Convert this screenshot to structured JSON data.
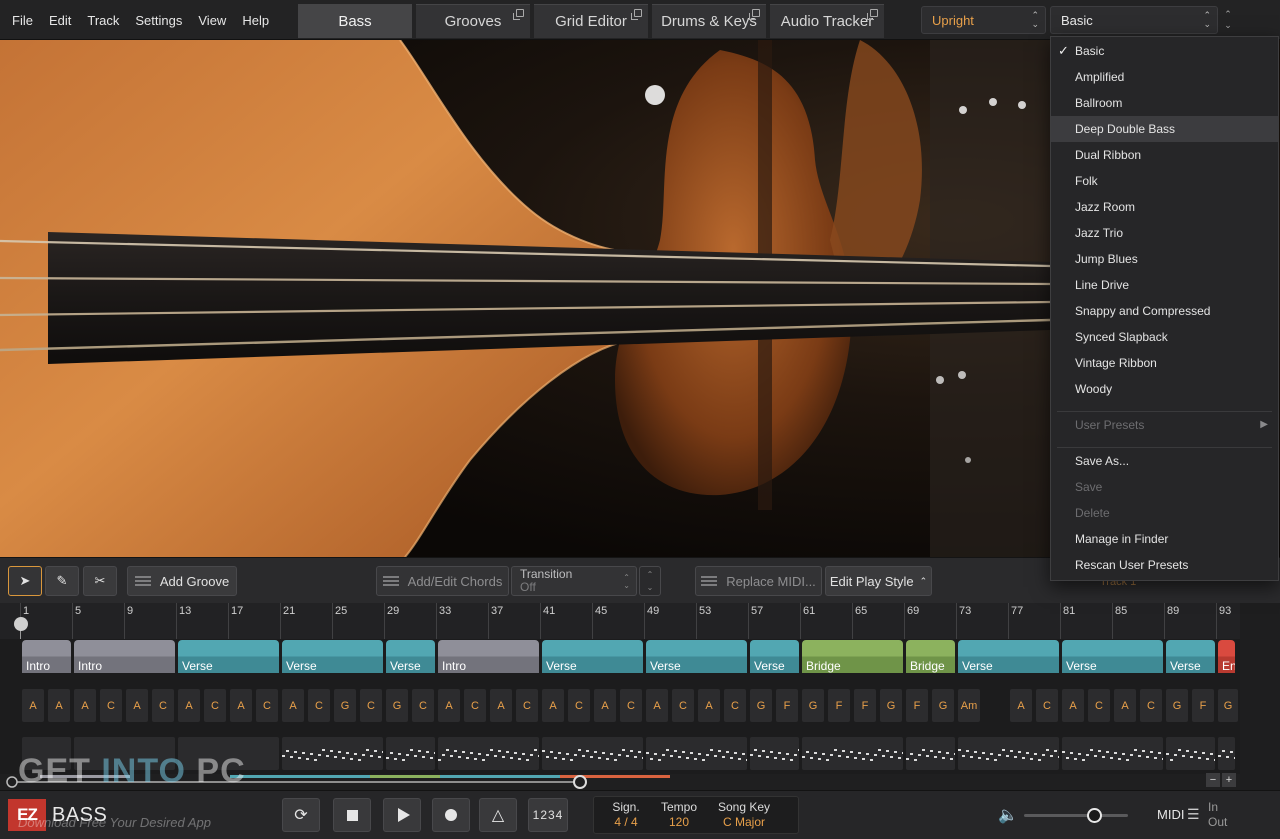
{
  "menu": [
    "File",
    "Edit",
    "Track",
    "Settings",
    "View",
    "Help"
  ],
  "tabs": [
    {
      "label": "Bass",
      "active": true,
      "popout": false
    },
    {
      "label": "Grooves",
      "active": false,
      "popout": true
    },
    {
      "label": "Grid Editor",
      "active": false,
      "popout": true
    },
    {
      "label": "Drums & Keys",
      "active": false,
      "popout": true
    },
    {
      "label": "Audio Tracker",
      "active": false,
      "popout": true
    }
  ],
  "style_select": {
    "value": "Upright"
  },
  "preset_select": {
    "value": "Basic"
  },
  "preset_menu": {
    "items": [
      {
        "label": "Basic",
        "checked": true
      },
      {
        "label": "Amplified"
      },
      {
        "label": "Ballroom"
      },
      {
        "label": "Deep Double Bass",
        "highlighted": true
      },
      {
        "label": "Dual Ribbon"
      },
      {
        "label": "Folk"
      },
      {
        "label": "Jazz Room"
      },
      {
        "label": "Jazz Trio"
      },
      {
        "label": "Jump Blues"
      },
      {
        "label": "Line Drive"
      },
      {
        "label": "Snappy and Compressed"
      },
      {
        "label": "Synced Slapback"
      },
      {
        "label": "Vintage Ribbon"
      },
      {
        "label": "Woody"
      }
    ],
    "user_presets": "User Presets",
    "actions": [
      {
        "label": "Save As...",
        "enabled": true
      },
      {
        "label": "Save",
        "enabled": false
      },
      {
        "label": "Delete",
        "enabled": false
      },
      {
        "label": "Manage in Finder",
        "enabled": true
      },
      {
        "label": "Rescan User Presets",
        "enabled": true
      }
    ]
  },
  "toolbar": {
    "add_groove": "Add Groove",
    "add_edit_chords": "Add/Edit Chords",
    "transition_label": "Transition",
    "transition_value": "Off",
    "replace_midi": "Replace MIDI...",
    "edit_play_style": "Edit Play Style",
    "track_label": "Track 1"
  },
  "ruler_bars": [
    "1",
    "5",
    "9",
    "13",
    "17",
    "21",
    "25",
    "29",
    "33",
    "37",
    "41",
    "45",
    "49",
    "53",
    "57",
    "61",
    "65",
    "69",
    "73",
    "77",
    "81",
    "85",
    "89",
    "93"
  ],
  "parts": [
    {
      "label": "Intro",
      "type": "intro",
      "start": 1,
      "len": 4
    },
    {
      "label": "Intro",
      "type": "intro",
      "start": 5,
      "len": 8
    },
    {
      "label": "Verse",
      "type": "verse",
      "start": 13,
      "len": 8
    },
    {
      "label": "Verse",
      "type": "verse",
      "start": 21,
      "len": 8
    },
    {
      "label": "Verse",
      "type": "verse",
      "start": 29,
      "len": 4
    },
    {
      "label": "Intro",
      "type": "intro",
      "start": 33,
      "len": 8
    },
    {
      "label": "Verse",
      "type": "verse",
      "start": 41,
      "len": 8
    },
    {
      "label": "Verse",
      "type": "verse",
      "start": 49,
      "len": 8
    },
    {
      "label": "Verse",
      "type": "verse",
      "start": 57,
      "len": 4
    },
    {
      "label": "Bridge",
      "type": "bridge",
      "start": 61,
      "len": 8
    },
    {
      "label": "Bridge",
      "type": "bridge",
      "start": 69,
      "len": 4
    },
    {
      "label": "Verse",
      "type": "verse",
      "start": 73,
      "len": 8
    },
    {
      "label": "Verse",
      "type": "verse",
      "start": 81,
      "len": 8
    },
    {
      "label": "Verse",
      "type": "verse",
      "start": 89,
      "len": 4
    },
    {
      "label": "En",
      "type": "ending",
      "start": 93,
      "len": 1.5
    }
  ],
  "chords": [
    "A",
    "A",
    "A",
    "C",
    "A",
    "C",
    "A",
    "C",
    "A",
    "C",
    "A",
    "C",
    "G",
    "C",
    "G",
    "C",
    "A",
    "C",
    "A",
    "C",
    "A",
    "C",
    "A",
    "C",
    "A",
    "C",
    "A",
    "C",
    "G",
    "F",
    "G",
    "F",
    "F",
    "G",
    "F",
    "G",
    "Am",
    "",
    "A",
    "C",
    "A",
    "C",
    "A",
    "C",
    "G",
    "F",
    "G",
    "F",
    "F"
  ],
  "transport": {
    "count_in": "1234",
    "signature_label": "Sign.",
    "signature_value": "4 / 4",
    "tempo_label": "Tempo",
    "tempo_value": "120",
    "song_key_label": "Song Key",
    "song_key_value": "C Major",
    "midi_label": "MIDI",
    "in_label": "In",
    "out_label": "Out",
    "volume_level": 0.68
  },
  "logo": {
    "ez": "EZ",
    "name": "BASS"
  },
  "watermark": {
    "get": "GET ",
    "into": "INTO",
    "pc": " PC",
    "sub": "Download Free Your Desired App"
  },
  "colors": {
    "accent": "#e8a04a",
    "intro": "#8f8f99",
    "verse": "#52a7b2",
    "bridge": "#8cb25e",
    "ending": "#d94a3f"
  }
}
